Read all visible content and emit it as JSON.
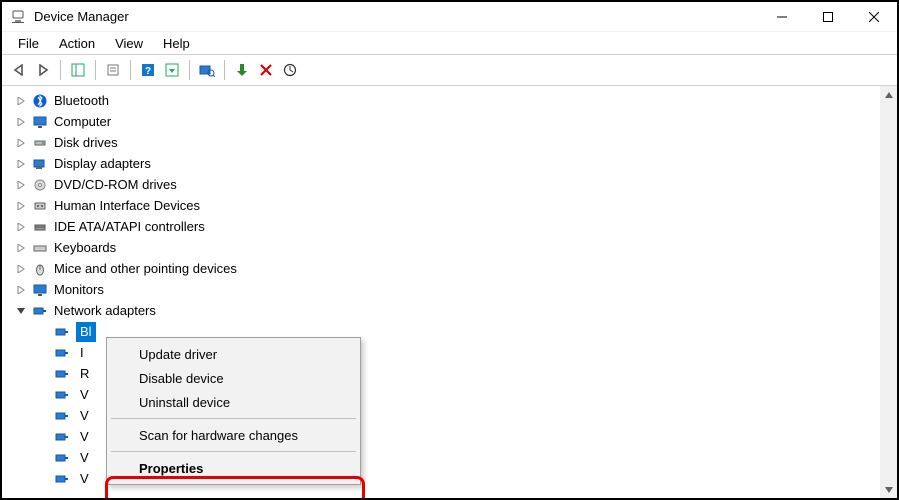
{
  "window": {
    "title": "Device Manager"
  },
  "menubar": {
    "file": "File",
    "action": "Action",
    "view": "View",
    "help": "Help"
  },
  "tree": {
    "bluetooth": "Bluetooth",
    "computer": "Computer",
    "disk_drives": "Disk drives",
    "display_adapters": "Display adapters",
    "dvd": "DVD/CD-ROM drives",
    "hid": "Human Interface Devices",
    "ide": "IDE ATA/ATAPI controllers",
    "keyboards": "Keyboards",
    "mice": "Mice and other pointing devices",
    "monitors": "Monitors",
    "network_adapters": "Network adapters"
  },
  "network_children": {
    "item0_partial": "Bl",
    "item1_partial": "I",
    "item2_partial": "R",
    "item3_partial": "V",
    "item4_partial": "V",
    "item5_partial": "V",
    "item6_partial": "V",
    "item7_partial": "V"
  },
  "context_menu": {
    "update_driver": "Update driver",
    "disable_device": "Disable device",
    "uninstall_device": "Uninstall device",
    "scan_hw": "Scan for hardware changes",
    "properties": "Properties"
  }
}
